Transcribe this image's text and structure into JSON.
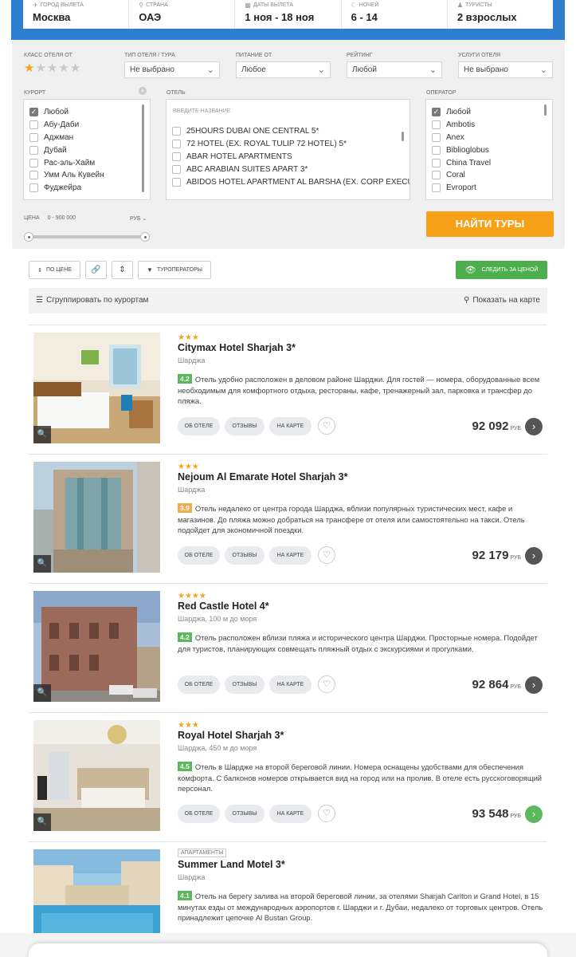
{
  "search": {
    "fields": [
      {
        "label": "Город вылета",
        "value": "Москва",
        "icon": "plane-icon"
      },
      {
        "label": "Страна",
        "value": "ОАЭ",
        "icon": "pin-icon"
      },
      {
        "label": "Даты вылета",
        "value": "1 ноя - 18 ноя",
        "icon": "calendar-icon"
      },
      {
        "label": "Ночей",
        "value": "6 - 14",
        "icon": "moon-icon"
      },
      {
        "label": "Туристы",
        "value": "2 взрослых",
        "icon": "person-icon"
      }
    ]
  },
  "filters": {
    "hotel_class_label": "Класс отеля от",
    "hotel_class_value": 1,
    "hotel_class_max": 5,
    "hotel_type_label": "Тип отеля / тура",
    "hotel_type_value": "Не выбрано",
    "meal_label": "Питание от",
    "meal_value": "Любое",
    "rating_label": "Рейтинг",
    "rating_value": "Любой",
    "services_label": "Услуги отеля",
    "services_value": "Не выбрано",
    "resort_label": "Курорт",
    "resorts": [
      {
        "name": "Любой",
        "checked": true
      },
      {
        "name": "Абу-Даби",
        "checked": false
      },
      {
        "name": "Аджман",
        "checked": false
      },
      {
        "name": "Дубай",
        "checked": false
      },
      {
        "name": "Рас-эль-Хайм",
        "checked": false
      },
      {
        "name": "Умм Аль Кувейн",
        "checked": false
      },
      {
        "name": "Фуджейра",
        "checked": false
      }
    ],
    "hotel_label": "Отель",
    "hotel_placeholder": "Введите название",
    "hotels": [
      "25HOURS DUBAI ONE CENTRAL 5*",
      "72 HOTEL (EX. ROYAL TULIP 72 HOTEL) 5*",
      "ABAR HOTEL APARTMENTS",
      "ABC ARABIAN SUITES APART 3*",
      "ABIDOS HOTEL APARTMENT AL BARSHA (EX. CORP EXECUTI..."
    ],
    "operator_label": "Оператор",
    "operators": [
      {
        "name": "Любой",
        "checked": true
      },
      {
        "name": "Ambotis",
        "checked": false
      },
      {
        "name": "Anex",
        "checked": false
      },
      {
        "name": "Biblioglobus",
        "checked": false
      },
      {
        "name": "China Travel",
        "checked": false
      },
      {
        "name": "Coral",
        "checked": false
      },
      {
        "name": "Evroport",
        "checked": false
      }
    ],
    "price_label": "Цена",
    "price_range": "0 - 900 000",
    "currency": "РУБ",
    "find_button": "Найти туры"
  },
  "toolbar": {
    "sort_price": "По цене",
    "operators": "Туроператоры",
    "track_price": "Следить за ценой",
    "group_by": "Сгруппировать по курортам",
    "show_map": "Показать на карте"
  },
  "card_actions": {
    "about": "Об отеле",
    "reviews": "Отзывы",
    "on_map": "На карте"
  },
  "hotels": [
    {
      "stars": 3,
      "type": "",
      "name": "Citymax Hotel Sharjah 3*",
      "location": "Шарджа",
      "rating": "4.2",
      "rating_color": "#5cb85c",
      "description": "Отель удобно расположен в деловом районе Шарджи. Для гостей — номера, оборудованные всем необходимым для комфортного отдыха, рестораны, кафе, тренажерный зал, парковка и трансфер до пляжа.",
      "price": "92 092",
      "currency": "РУБ",
      "photo": "room",
      "arrow_color": "#555"
    },
    {
      "stars": 3,
      "type": "",
      "name": "Nejoum Al Emarate Hotel Sharjah 3*",
      "location": "Шарджа",
      "rating": "3.9",
      "rating_color": "#f0ad4e",
      "description": "Отель недалеко от центра города Шарджа, вблизи популярных туристических мест, кафе и магазинов. До пляжа можно добраться на трансфере от отеля или самостоятельно на такси. Отель подойдет для экономичной поездки.",
      "price": "92 179",
      "currency": "РУБ",
      "photo": "tower",
      "arrow_color": "#555"
    },
    {
      "stars": 4,
      "type": "",
      "name": "Red Castle Hotel 4*",
      "location": "Шарджа, 100 м до моря",
      "rating": "4.2",
      "rating_color": "#5cb85c",
      "description": "Отель расположен вблизи пляжа и исторического центра Шарджи. Просторные номера. Подойдет для туристов, планирующих совмещать пляжный отдых с экскурсиями и прогулками.",
      "price": "92 864",
      "currency": "РУБ",
      "photo": "castle",
      "arrow_color": "#555"
    },
    {
      "stars": 3,
      "type": "",
      "name": "Royal Hotel Sharjah 3*",
      "location": "Шарджа, 450 м до моря",
      "rating": "4.5",
      "rating_color": "#5cb85c",
      "description": "Отель в Шардже на второй береговой линии. Номера оснащены удобствами для обеспечения комфорта. С балконов номеров открывается вид на город или на пролив. В отеле есть русскоговорящий персонал.",
      "price": "93 548",
      "currency": "РУБ",
      "photo": "suite",
      "arrow_color": "#5cb85c"
    },
    {
      "stars": 0,
      "type": "Апартаменты",
      "name": "Summer Land Motel 3*",
      "location": "Шарджа",
      "rating": "4.1",
      "rating_color": "#5cb85c",
      "description": "Отель на берегу залива на второй береговой линии, за отелями Sharjah Carlton и Grand Hotel, в 15 минутах езды от международных аэропортов г. Шарджи и г. Дубаи, недалеко от торговых центров. Отель принадлежит цепочке Al Bustan Group.",
      "price": "",
      "currency": "",
      "photo": "pool",
      "arrow_color": "#555"
    }
  ]
}
